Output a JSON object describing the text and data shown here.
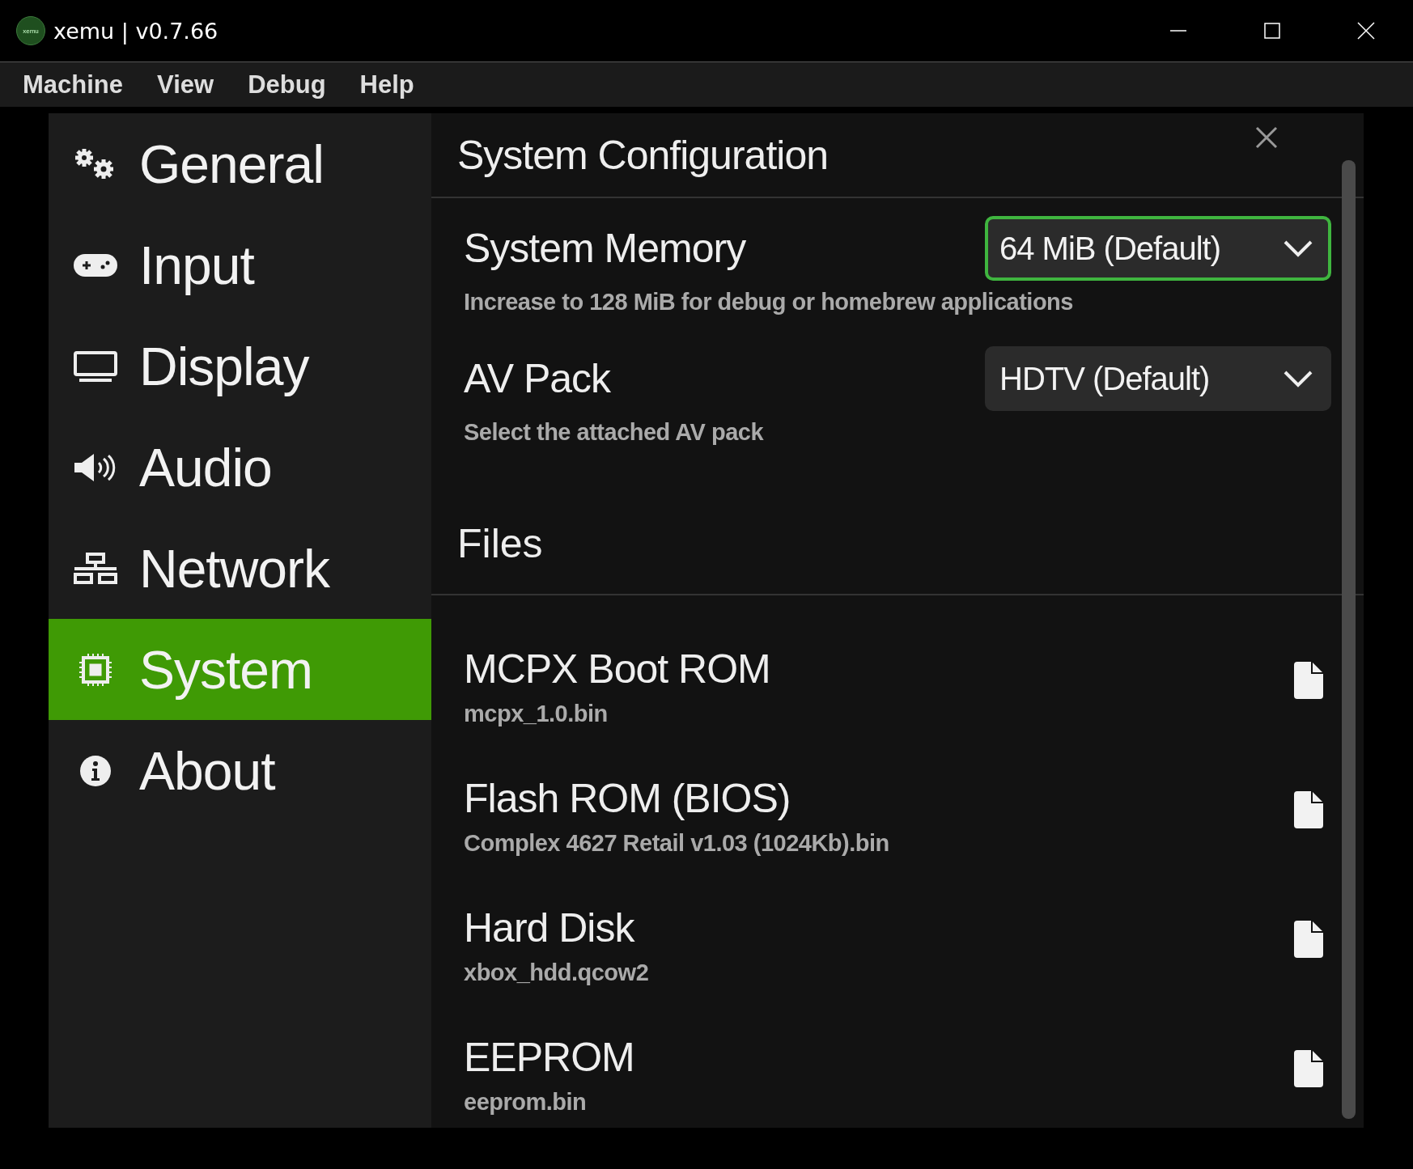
{
  "window": {
    "title": "xemu | v0.7.66",
    "logo_text": "xemu"
  },
  "menu": [
    "Machine",
    "View",
    "Debug",
    "Help"
  ],
  "sidebar": {
    "items": [
      {
        "label": "General",
        "selected": false
      },
      {
        "label": "Input",
        "selected": false
      },
      {
        "label": "Display",
        "selected": false
      },
      {
        "label": "Audio",
        "selected": false
      },
      {
        "label": "Network",
        "selected": false
      },
      {
        "label": "System",
        "selected": true
      },
      {
        "label": "About",
        "selected": false
      }
    ]
  },
  "panel": {
    "title": "System Configuration",
    "settings": [
      {
        "label": "System Memory",
        "description": "Increase to 128 MiB for debug or homebrew applications",
        "value": "64 MiB (Default)",
        "focused": true
      },
      {
        "label": "AV Pack",
        "description": "Select the attached AV pack",
        "value": "HDTV (Default)",
        "focused": false
      }
    ],
    "files_title": "Files",
    "files": [
      {
        "label": "MCPX Boot ROM",
        "value": "mcpx_1.0.bin"
      },
      {
        "label": "Flash ROM (BIOS)",
        "value": "Complex 4627 Retail v1.03 (1024Kb).bin"
      },
      {
        "label": "Hard Disk",
        "value": "xbox_hdd.qcow2"
      },
      {
        "label": "EEPROM",
        "value": "eeprom.bin"
      }
    ]
  }
}
